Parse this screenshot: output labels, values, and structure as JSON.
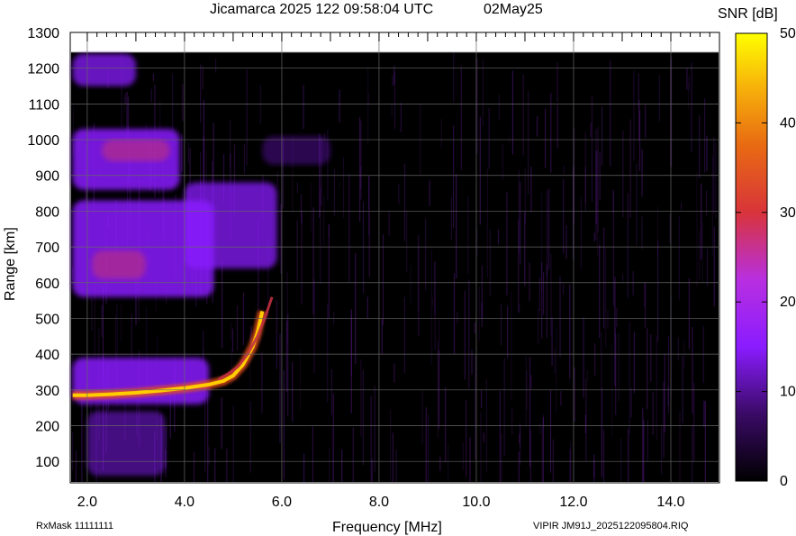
{
  "chart_data": {
    "type": "heatmap",
    "title": "Jicamarca 2025 122 09:58:04 UTC",
    "date_label": "02May25",
    "xlabel": "Frequency [MHz]",
    "ylabel": "Range [km]",
    "xlim": [
      1.65,
      15.0
    ],
    "ylim": [
      40,
      1300
    ],
    "data_ylim_top": 1245,
    "x_ticks": [
      2.0,
      4.0,
      6.0,
      8.0,
      10.0,
      12.0,
      14.0
    ],
    "x_tick_labels": [
      "2.0",
      "4.0",
      "6.0",
      "8.0",
      "10.0",
      "12.0",
      "14.0"
    ],
    "y_ticks": [
      100,
      200,
      300,
      400,
      500,
      600,
      700,
      800,
      900,
      1000,
      1100,
      1200,
      1300
    ],
    "y_tick_labels": [
      "100",
      "200",
      "300",
      "400",
      "500",
      "600",
      "700",
      "800",
      "900",
      "1000",
      "1100",
      "1200",
      "1300"
    ],
    "colorbar": {
      "label": "SNR [dB]",
      "range": [
        0,
        50
      ],
      "ticks": [
        0,
        10,
        20,
        30,
        40,
        50
      ],
      "tick_labels": [
        "0",
        "10",
        "20",
        "30",
        "40",
        "50"
      ]
    },
    "traces": [
      {
        "name": "",
        "x": [
          1.7,
          2.0,
          2.5,
          3.0,
          3.5,
          4.0,
          4.5,
          4.8,
          5.0,
          5.2,
          5.4,
          5.5,
          5.6
        ],
        "y": [
          285,
          285,
          288,
          292,
          298,
          305,
          315,
          325,
          340,
          370,
          420,
          460,
          520
        ]
      },
      {
        "name": "",
        "x": [
          4.7,
          4.9,
          5.1,
          5.3,
          5.5,
          5.65,
          5.8
        ],
        "y": [
          330,
          345,
          365,
          400,
          450,
          500,
          560
        ]
      }
    ],
    "grid": true
  },
  "footer": {
    "rxmask": "RxMask 11111111",
    "file": "VIPIR  JM91J_2025122095804.RIQ"
  },
  "colors": {
    "background": "#000000",
    "grid": "#666666",
    "low": "#0a0010",
    "mid": "#8a1cff",
    "high": "#ffee00"
  }
}
